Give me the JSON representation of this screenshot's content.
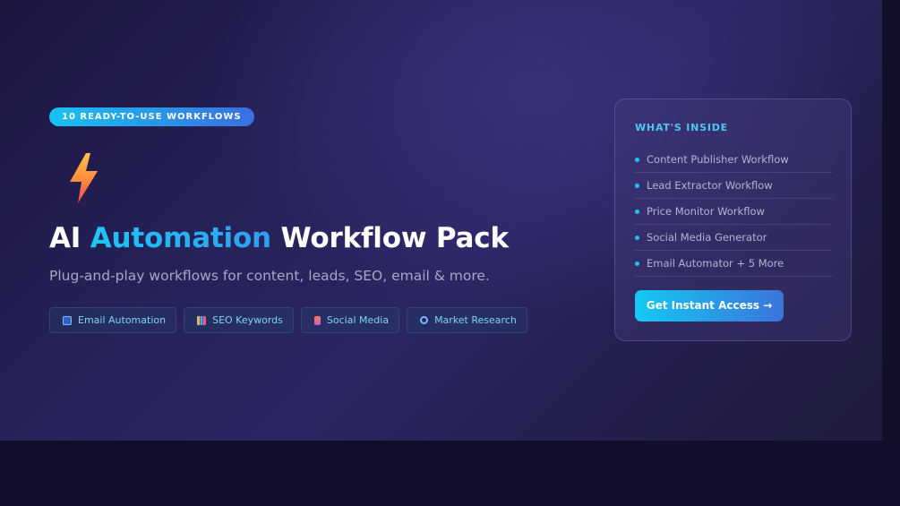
{
  "hero": {
    "badge": "10 READY-TO-USE WORKFLOWS",
    "icon": "lightning-bolt-icon",
    "title": {
      "before": "AI ",
      "accent": "Automation",
      "after": " Workflow Pack"
    },
    "subtitle": "Plug-and-play workflows for content, leads, SEO, email & more.",
    "tags": [
      {
        "icon": "email-icon",
        "label": "Email Automation"
      },
      {
        "icon": "chart-icon",
        "label": "SEO Keywords"
      },
      {
        "icon": "social-media-icon",
        "label": "Social Media"
      },
      {
        "icon": "magnifier-icon",
        "label": "Market Research"
      }
    ]
  },
  "card": {
    "heading": "WHAT'S INSIDE",
    "items": [
      "Content Publisher Workflow",
      "Lead Extractor Workflow",
      "Price Monitor Workflow",
      "Social Media Generator",
      "Email Automator + 5 More"
    ],
    "cta_label": "Get Instant Access →"
  },
  "colors": {
    "accent_cyan": "#1fc6f5",
    "accent_blue": "#3b73dc",
    "background": "#110e2b",
    "hero_background": "#272259"
  }
}
